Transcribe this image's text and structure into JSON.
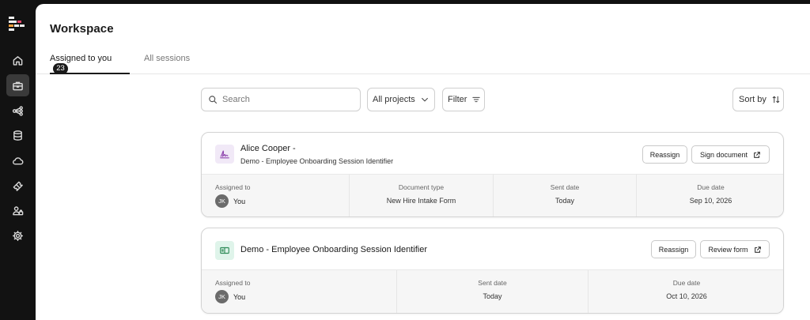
{
  "page": {
    "title": "Workspace"
  },
  "tabs": [
    {
      "label": "Assigned to you",
      "badge": "23"
    },
    {
      "label": "All sessions"
    }
  ],
  "toolbar": {
    "search_placeholder": "Search",
    "projects_label": "All projects",
    "filter_label": "Filter",
    "sort_label": "Sort by"
  },
  "sidebar": {
    "items": [
      {
        "icon": "home-icon"
      },
      {
        "icon": "briefcase-icon",
        "active": true
      },
      {
        "icon": "workflow-icon"
      },
      {
        "icon": "database-icon"
      },
      {
        "icon": "cloud-icon"
      },
      {
        "icon": "ticket-icon"
      },
      {
        "icon": "users-icon"
      },
      {
        "icon": "settings-icon"
      }
    ]
  },
  "cards": [
    {
      "title": "Alice Cooper -",
      "subtitle": "Demo - Employee Onboarding Session Identifier",
      "icon": "signature-icon",
      "icon_color": "#8e44ad",
      "icon_bg": "#f1e9f7",
      "reassign_label": "Reassign",
      "action_label": "Sign document",
      "columns": [
        {
          "label": "Assigned to",
          "initials": "JK",
          "value": "You"
        },
        {
          "label": "Document type",
          "value": "New Hire Intake Form"
        },
        {
          "label": "Sent date",
          "value": "Today"
        },
        {
          "label": "Due date",
          "value": "Sep 10, 2026"
        }
      ]
    },
    {
      "title": "Demo - Employee Onboarding Session Identifier",
      "icon": "form-icon",
      "icon_color": "#2e8b57",
      "icon_bg": "#dff4ea",
      "reassign_label": "Reassign",
      "action_label": "Review form",
      "columns": [
        {
          "label": "Assigned to",
          "initials": "JK",
          "value": "You"
        },
        {
          "label": "Sent date",
          "value": "Today"
        },
        {
          "label": "Due date",
          "value": "Oct 10, 2026"
        }
      ]
    }
  ]
}
